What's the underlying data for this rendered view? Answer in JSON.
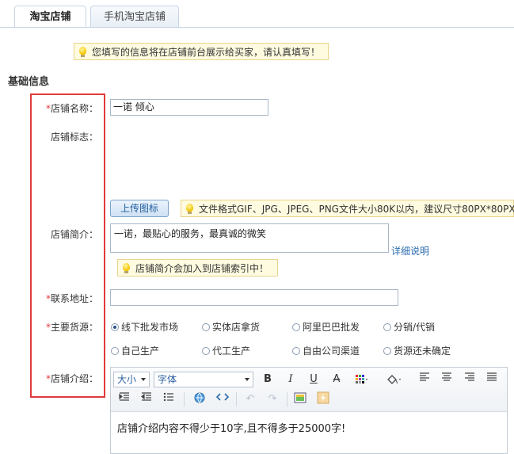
{
  "tabs": [
    {
      "label": "淘宝店铺",
      "active": true
    },
    {
      "label": "手机淘宝店铺",
      "active": false
    }
  ],
  "notice": "您填写的信息将在店铺前台展示给买家，请认真填写！",
  "section_title": "基础信息",
  "fields": {
    "shop_name": {
      "label": "店铺名称：",
      "required": true,
      "value": "一诺 倾心"
    },
    "shop_logo": {
      "label": "店铺标志："
    },
    "upload_button": "上传图标",
    "logo_tip": "文件格式GIF、JPG、JPEG、PNG文件大小80K以内，建议尺寸80PX*80PX",
    "shop_intro": {
      "label": "店铺简介：",
      "value": "一诺，最贴心的服务，最真诚的微笑"
    },
    "detail_link": "详细说明",
    "intro_tip": "店铺简介会加入到店铺索引中！",
    "address": {
      "label": "联系地址：",
      "required": true,
      "value": ""
    },
    "source": {
      "label": "主要货源：",
      "required": true,
      "options": [
        "线下批发市场",
        "实体店拿货",
        "阿里巴巴批发",
        "分销/代销",
        "自己生产",
        "代工生产",
        "自由公司渠道",
        "货源还未确定"
      ],
      "selected_index": 0
    },
    "description": {
      "label": "店铺介绍：",
      "required": true
    }
  },
  "editor": {
    "font_size": "大小",
    "font_family": "字体",
    "content": "店铺介绍内容不得少于10字,且不得多于25000字!"
  },
  "asterisk": "*",
  "colors": {
    "accent_red": "#e03a3a",
    "tip_bg": "#fffbe0",
    "link": "#2b6cb0"
  }
}
